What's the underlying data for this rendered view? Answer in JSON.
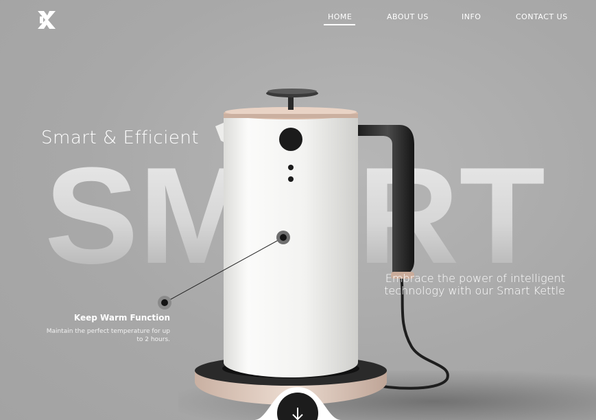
{
  "brand": {
    "logo_icon": "x-logo-icon"
  },
  "nav": {
    "items": [
      {
        "label": "HOME",
        "active": true
      },
      {
        "label": "ABOUT US",
        "active": false
      },
      {
        "label": "INFO",
        "active": false
      },
      {
        "label": "CONTACT US",
        "active": false
      }
    ]
  },
  "hero": {
    "tagline": "Smart & Efficient",
    "big_word": "SMART",
    "description": "Embrace the power of intelligent technology with our Smart Kettle",
    "feature": {
      "title": "Keep Warm Function",
      "description": "Maintain the perfect temperature for up to 2 hours."
    },
    "scroll_icon": "arrow-down-icon"
  },
  "colors": {
    "background": "#a9a9a9",
    "text": "#ffffff",
    "kettle_body": "#f4f4f2",
    "kettle_accent": "#c9ab9a",
    "dark": "#1c1c1c"
  }
}
